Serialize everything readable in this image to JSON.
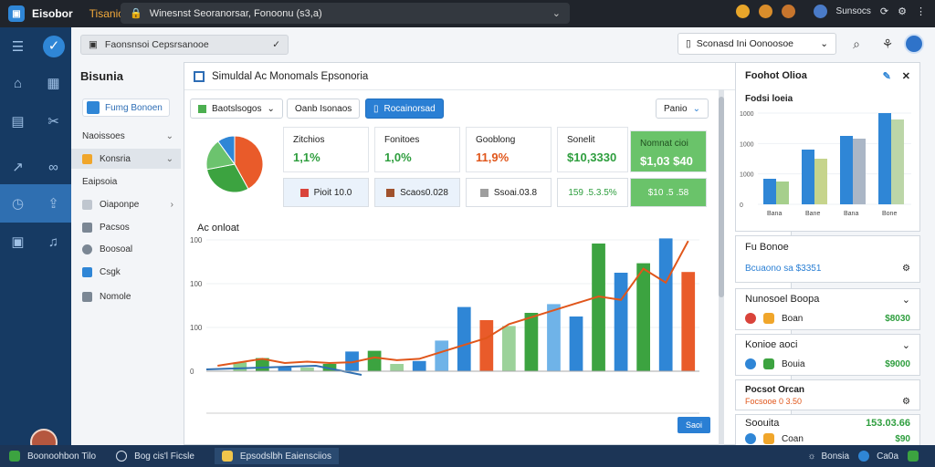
{
  "titlebar": {
    "app_name": "Eisobor",
    "tab": "Tisanio",
    "url": "Winesnst Seoranorsar, Fonoonu (s3,a)",
    "icons": [
      "emoji-icon",
      "emoji-icon",
      "emoji-icon",
      "globe-icon",
      "notifications-icon",
      "refresh-icon",
      "settings-icon",
      "more-icon"
    ]
  },
  "header": {
    "breadcrumb": "Faonsnsoi Cepsrsanooe",
    "select": "Sconasd Ini Oonoosoe"
  },
  "nav": {
    "title": "Bisunia",
    "button": "Fumg Bonoen",
    "items": [
      {
        "label": "Naoissoes",
        "caret": "⌄"
      },
      {
        "label": "Konsria",
        "caret": "⌄"
      },
      {
        "label": "Eaipsoia",
        "caret": ""
      },
      {
        "label": "Oiaponpe",
        "caret": "›"
      },
      {
        "label": "Pacsos",
        "caret": ""
      },
      {
        "label": "Boosoal",
        "caret": ""
      },
      {
        "label": "Csgk",
        "caret": ""
      },
      {
        "label": "Nomole",
        "caret": ""
      }
    ]
  },
  "panel": {
    "title": "Simuldal Ac Monomals Epsonoria",
    "toolbar": [
      "Baotslsogos",
      "Oanb Isonaos",
      "Rocainorsad",
      "Panio"
    ],
    "kpis": [
      {
        "label": "Zitchios",
        "value": "1,1%",
        "color": "#2e9e3e"
      },
      {
        "label": "Fonitoes",
        "value": "1,0%",
        "color": "#2e9e3e"
      },
      {
        "label": "Gooblong",
        "value": "11,9%",
        "color": "#e0561b"
      },
      {
        "label": "Sonelit",
        "value": "$10,3330",
        "color": "#2e9e3e"
      },
      {
        "label": "Nomnat cioi",
        "value": "$1,03 $40",
        "color": "#ffffff"
      }
    ],
    "kpis2": [
      {
        "label": "Pioit 10.0",
        "color": "#d9433a"
      },
      {
        "label": "Scaos0.028",
        "color": "#a0522d"
      },
      {
        "label": "Ssoai.03.8",
        "color": "#9e9e9e"
      },
      {
        "label": "159 .5.3.5%",
        "color": "#2e9e3e"
      },
      {
        "label": "$10 .5 .58",
        "color": "#ffffff"
      }
    ],
    "chart_title": "Ac onloat",
    "save_label": "Saoi"
  },
  "right_panel": {
    "title": "Foohot Olioa",
    "chart_title": "Fodsi loeia",
    "filter_label": "Fu Bonoe",
    "filter_value": "Bcuaono sa $3351",
    "sections": [
      {
        "title": "Nunosoel Boopa",
        "row_label": "Boan",
        "row_value": "$8030"
      },
      {
        "title": "Konioe aoci",
        "row_label": "Bouia",
        "row_value": "$9000"
      },
      {
        "title": "Pocsot Orcan",
        "row_label": "Focsooe 0 3.50",
        "row_value": ""
      },
      {
        "title": "Soouita",
        "row_label": "Coan",
        "row_value": "153.03.66",
        "row_value2": "$90"
      }
    ]
  },
  "bottombar": {
    "items": [
      "Boonoohbon Tilo",
      "Bog cis'l Ficsle",
      "Epsodslbh Eaiensciios"
    ],
    "right": [
      "Bonsia",
      "Ca0a"
    ]
  },
  "chart_data": [
    {
      "type": "pie",
      "values": [
        0.42,
        0.3,
        0.18,
        0.1
      ],
      "colors": [
        "#e95b2a",
        "#3ca340",
        "#6cc36e",
        "#2f86d6"
      ]
    },
    {
      "type": "bar",
      "title": "Ac onloat",
      "ylim": [
        0,
        180
      ],
      "y_ticks": [
        "0",
        "100",
        "100",
        "100"
      ],
      "series": [
        {
          "values": [
            0,
            12,
            18,
            5,
            5,
            10,
            27,
            28,
            10,
            14,
            42,
            88,
            70,
            62,
            80,
            92,
            75,
            175,
            135,
            148,
            182,
            136
          ]
        },
        {
          "values": [
            0,
            5,
            10,
            4,
            6,
            4,
            5,
            12,
            8,
            10,
            20,
            30,
            40,
            60,
            70,
            80,
            90,
            100,
            95,
            140,
            120,
            180
          ]
        }
      ]
    },
    {
      "type": "bar",
      "title": "Fodsi loeia",
      "y_ticks": [
        "0",
        "1000",
        "1000",
        "1000"
      ],
      "categories": [
        "Bana",
        "Bane",
        "Bana",
        "Bone"
      ],
      "values_series": [
        [
          0.28,
          0.6,
          0.75,
          1.0
        ],
        [
          0.25,
          0.5,
          0.72,
          0.93
        ]
      ]
    }
  ]
}
